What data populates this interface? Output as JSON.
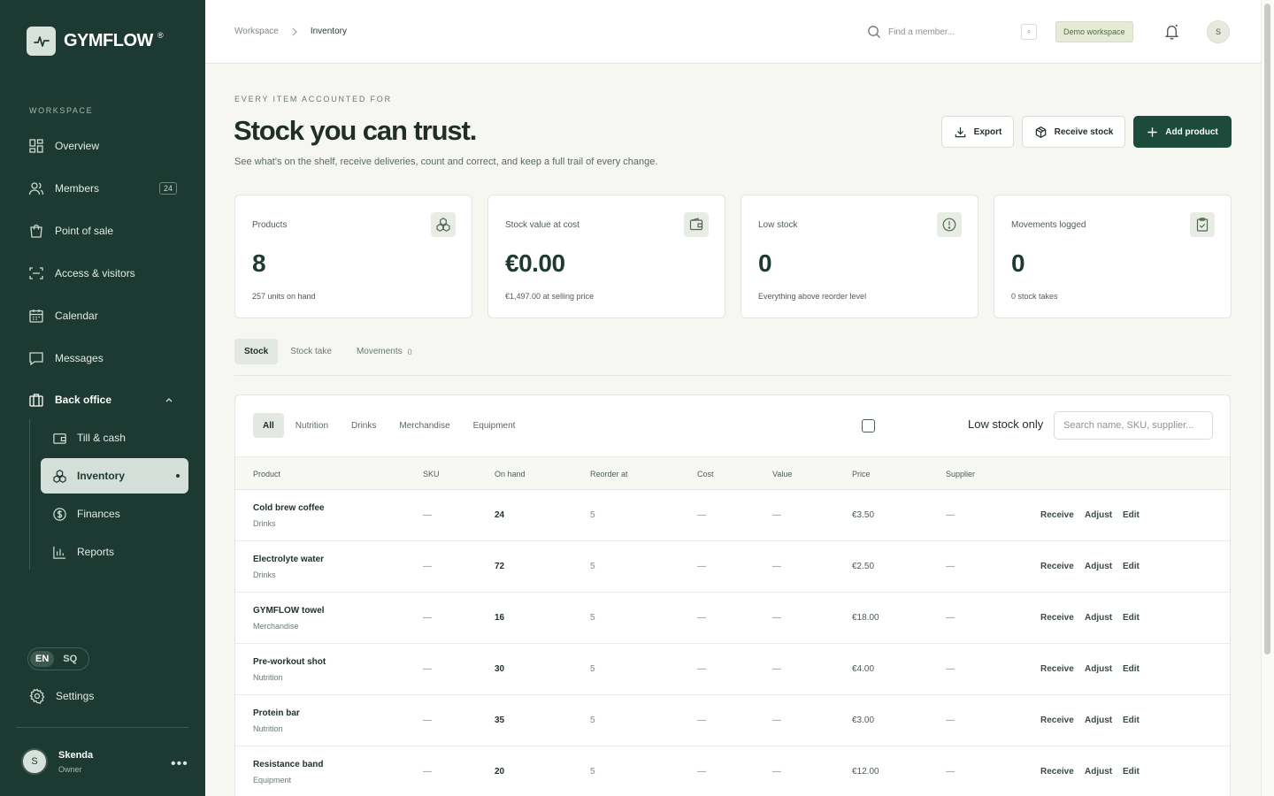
{
  "sidebar": {
    "brand": "GYMFLOW",
    "brand_mark": "®",
    "section_label": "WORKSPACE",
    "items": [
      {
        "label": "Overview"
      },
      {
        "label": "Members",
        "badge": "24"
      },
      {
        "label": "Point of sale"
      },
      {
        "label": "Access & visitors"
      },
      {
        "label": "Calendar"
      },
      {
        "label": "Messages"
      },
      {
        "label": "Back office"
      }
    ],
    "sub_items": [
      {
        "label": "Till & cash"
      },
      {
        "label": "Inventory"
      },
      {
        "label": "Finances"
      },
      {
        "label": "Reports"
      }
    ],
    "lang": {
      "en": "EN",
      "sq": "SQ"
    },
    "settings": "Settings",
    "user": {
      "initial": "S",
      "name": "Skenda",
      "role": "Owner",
      "more": "•••"
    }
  },
  "topbar": {
    "crumb_root": "Workspace",
    "crumb_current": "Inventory",
    "search_placeholder": "Find a member...",
    "search_kbd": "⌕",
    "workspace_badge": "Demo workspace",
    "avatar_initial": "S"
  },
  "header": {
    "eyebrow": "EVERY ITEM ACCOUNTED FOR",
    "title": "Stock you can trust.",
    "subtitle": "See what's on the shelf, receive deliveries, count and correct, and keep a full trail of every change.",
    "export": "Export",
    "receive": "Receive stock",
    "add": "Add product"
  },
  "stats": [
    {
      "label": "Products",
      "value": "8",
      "sub": "257 units on hand",
      "icon": "boxes-icon"
    },
    {
      "label": "Stock value at cost",
      "value": "€0.00",
      "sub": "€1,497.00 at selling price",
      "icon": "wallet-icon"
    },
    {
      "label": "Low stock",
      "value": "0",
      "sub": "Everything above reorder level",
      "icon": "alert-circle-icon"
    },
    {
      "label": "Movements logged",
      "value": "0",
      "sub": "0 stock takes",
      "icon": "clipboard-check-icon"
    }
  ],
  "tabs": [
    {
      "label": "Stock"
    },
    {
      "label": "Stock take"
    },
    {
      "label": "Movements",
      "count": "0"
    }
  ],
  "filters": [
    "All",
    "Nutrition",
    "Drinks",
    "Merchandise",
    "Equipment"
  ],
  "low_stock_label": "Low stock only",
  "product_search_placeholder": "Search name, SKU, supplier...",
  "table": {
    "headers": [
      "Product",
      "SKU",
      "On hand",
      "Reorder at",
      "Cost",
      "Value",
      "Price",
      "Supplier"
    ],
    "actions": [
      "Receive",
      "Adjust",
      "Edit"
    ],
    "rows": [
      {
        "name": "Cold brew coffee",
        "category": "Drinks",
        "sku": "—",
        "on_hand": "24",
        "reorder": "5",
        "cost": "—",
        "value": "—",
        "price": "€3.50",
        "supplier": "—"
      },
      {
        "name": "Electrolyte water",
        "category": "Drinks",
        "sku": "—",
        "on_hand": "72",
        "reorder": "5",
        "cost": "—",
        "value": "—",
        "price": "€2.50",
        "supplier": "—"
      },
      {
        "name": "GYMFLOW towel",
        "category": "Merchandise",
        "sku": "—",
        "on_hand": "16",
        "reorder": "5",
        "cost": "—",
        "value": "—",
        "price": "€18.00",
        "supplier": "—"
      },
      {
        "name": "Pre-workout shot",
        "category": "Nutrition",
        "sku": "—",
        "on_hand": "30",
        "reorder": "5",
        "cost": "—",
        "value": "—",
        "price": "€4.00",
        "supplier": "—"
      },
      {
        "name": "Protein bar",
        "category": "Nutrition",
        "sku": "—",
        "on_hand": "35",
        "reorder": "5",
        "cost": "—",
        "value": "—",
        "price": "€3.00",
        "supplier": "—"
      },
      {
        "name": "Resistance band",
        "category": "Equipment",
        "sku": "—",
        "on_hand": "20",
        "reorder": "5",
        "cost": "—",
        "value": "—",
        "price": "€12.00",
        "supplier": "—"
      }
    ]
  }
}
